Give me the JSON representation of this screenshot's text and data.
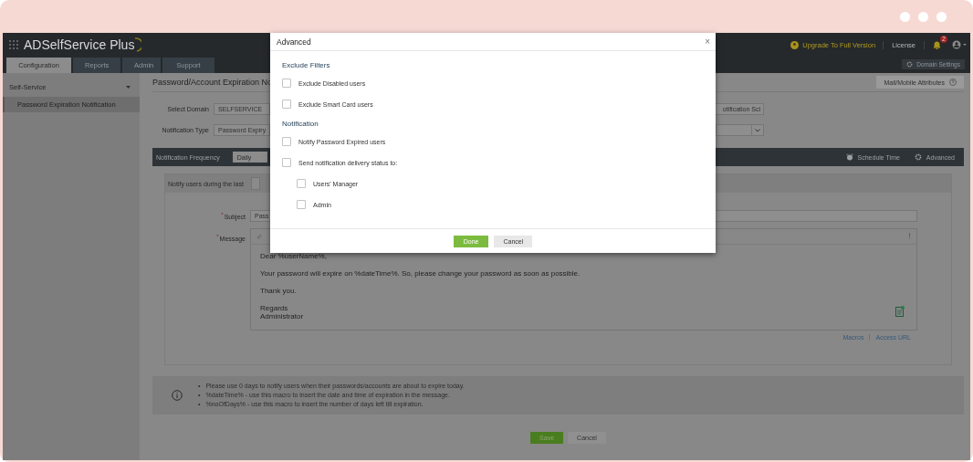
{
  "app": {
    "logo": "ADSelfService Plus",
    "upgrade": "Upgrade To Full Version",
    "license": "License",
    "alert_count": "2",
    "domain_settings": "Domain Settings",
    "tabs": [
      {
        "label": "Configuration",
        "selected": true
      },
      {
        "label": "Reports",
        "selected": false
      },
      {
        "label": "Admin",
        "selected": false
      },
      {
        "label": "Support",
        "selected": false
      }
    ]
  },
  "sidebar": {
    "section": "Self-Service",
    "items": [
      {
        "label": "Password Expiration Notification",
        "selected": true
      }
    ]
  },
  "page": {
    "title": "Password/Account Expiration No",
    "mail_button": "Mail/Mobile Attributes",
    "domain": {
      "label": "Select Domain",
      "value": "SELFSERVICE"
    },
    "scheduler_button": "otification Scl",
    "type": {
      "label": "Notification Type",
      "value": "Password Expiry"
    },
    "frequency": {
      "label": "Notification Frequency",
      "value": "Daily"
    },
    "schedule_time": "Schedule Time",
    "advanced": "Advanced",
    "notify_label": "Notify users during the last",
    "subject": {
      "required_mark": "*",
      "label": "Subject",
      "value": "Pass"
    },
    "message": {
      "required_mark": "*",
      "label": "Message",
      "paragraphs": [
        "Dear %userName%,",
        "Your password will expire on %dateTime%. So, please change your password as soon as possible.",
        "Thank you.",
        "Regards\nAdministrator"
      ]
    },
    "links": [
      "Macros",
      "Access URL"
    ],
    "info": [
      {
        "bullet": "•",
        "text": "Please use 0 days to notify users when their passwords/accounts are about to expire today."
      },
      {
        "bullet": "•",
        "text": "%dateTime% - use this macro to insert the date and time of expiration in the message."
      },
      {
        "bullet": "•",
        "text": "%noOfDays% - use this macro to insert the number of days left till expiration."
      }
    ],
    "save": "Save",
    "cancel": "Cancel"
  },
  "dialog": {
    "title": "Advanced",
    "close": "×",
    "sections": [
      {
        "heading": "Exclude Filters",
        "options": [
          {
            "label": "Exclude Disabled users",
            "checked": false
          },
          {
            "label": "Exclude Smart Card users",
            "checked": false
          }
        ]
      },
      {
        "heading": "Notification",
        "options": [
          {
            "label": "Notify Password Expired users",
            "checked": false
          },
          {
            "label": "Send notification delivery status to:",
            "checked": false,
            "children": [
              {
                "label": "Users' Manager",
                "checked": false
              },
              {
                "label": "Admin",
                "checked": false
              }
            ]
          }
        ]
      }
    ],
    "done": "Done",
    "cancel": "Cancel"
  }
}
